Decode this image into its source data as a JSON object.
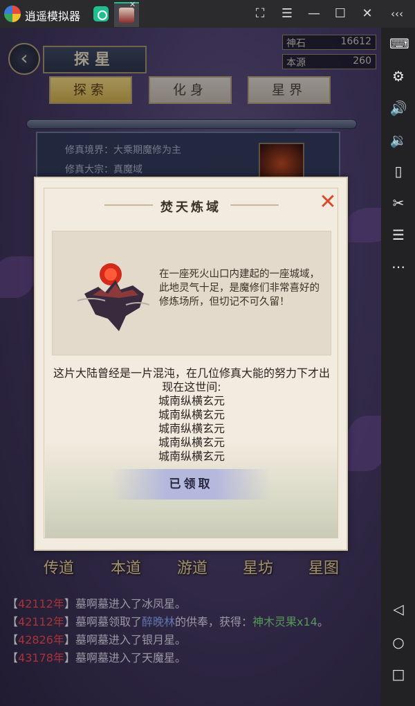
{
  "emulator": {
    "app_name": "逍遥模拟器",
    "controls": {
      "screenshot": "⛶",
      "menu": "☰",
      "minimize": "—",
      "maximize": "☐",
      "close": "✕",
      "collapse": "‹‹‹"
    },
    "tab_close": "✕"
  },
  "sidebar": {
    "items": [
      "keyboard-icon",
      "settings-icon",
      "volume-up-icon",
      "volume-down-icon",
      "rotate-icon",
      "scissors-icon",
      "list-icon",
      "more-icon",
      "back-icon",
      "home-icon",
      "recents-icon"
    ]
  },
  "game": {
    "back_glyph": "‹",
    "page_title": "探星",
    "resources": [
      {
        "name": "神石",
        "value": "16612"
      },
      {
        "name": "本源",
        "value": "260"
      }
    ],
    "tabs": [
      {
        "label": "探索",
        "active": true
      },
      {
        "label": "化身",
        "active": false
      },
      {
        "label": "星界",
        "active": false
      }
    ],
    "info": {
      "realm": "修真境界：大乘期魔修为主",
      "sect": "修真大宗：真魔域"
    },
    "bottom_nav": [
      "传道",
      "本道",
      "游道",
      "星坊",
      "星图"
    ],
    "log": [
      {
        "year": "42112年",
        "text": "墓啊墓进入了冰凤星。"
      },
      {
        "year": "42112年",
        "pre": "墓啊墓领取了",
        "name": "醉晚林",
        "mid": "的供奉，获得：",
        "item": "神木灵果x14",
        "post": "。"
      },
      {
        "year": "42826年",
        "text": "墓啊墓进入了银月星。"
      },
      {
        "year": "43178年",
        "text": "墓啊墓进入了天魔星。"
      }
    ],
    "bracket_open": "【",
    "bracket_close": "】"
  },
  "modal": {
    "title": "焚天炼域",
    "close_glyph": "✕",
    "description": "在一座死火山口内建起的一座城域，此地灵气十足，是魔修们非常喜好的修炼场所，但切记不可久留！",
    "story": "这片大陆曾经是一片混沌，在几位修真大能的努力下才出现在这世间:",
    "rewards": [
      "城南纵横玄元",
      "城南纵横玄元",
      "城南纵横玄元",
      "城南纵横玄元",
      "城南纵横玄元"
    ],
    "claim_button": "已领取"
  }
}
